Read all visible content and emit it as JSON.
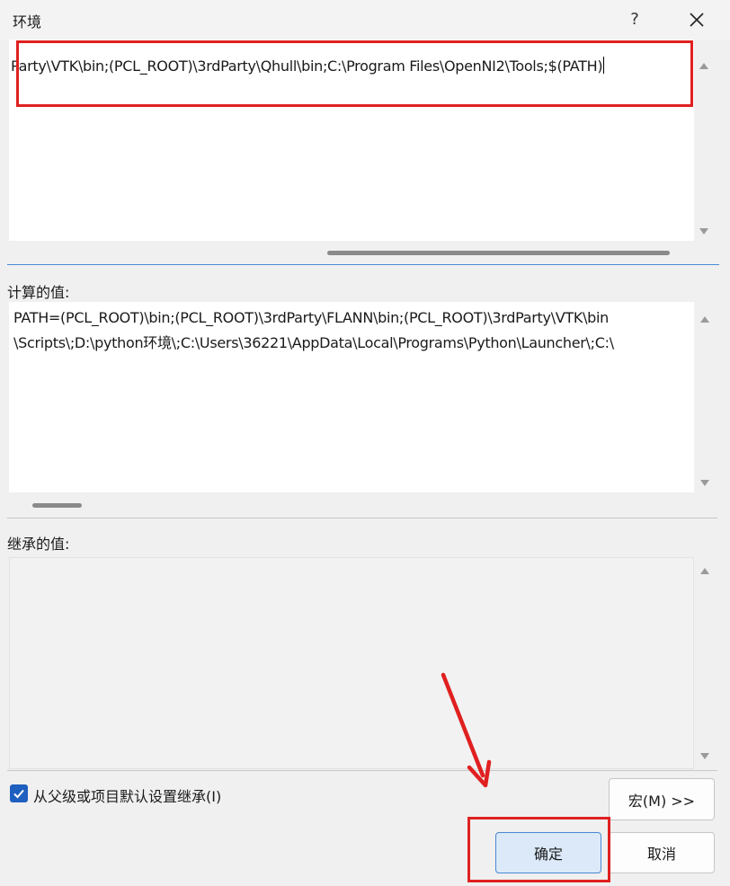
{
  "window": {
    "title": "环境",
    "help_label": "?"
  },
  "editor": {
    "text": "Party\\VTK\\bin;(PCL_ROOT)\\3rdParty\\Qhull\\bin;C:\\Program Files\\OpenNI2\\Tools;$(PATH)"
  },
  "computed": {
    "label": "计算的值:",
    "lines": [
      "PATH=(PCL_ROOT)\\bin;(PCL_ROOT)\\3rdParty\\FLANN\\bin;(PCL_ROOT)\\3rdParty\\VTK\\bin",
      "\\Scripts\\;D:\\python环境\\;C:\\Users\\36221\\AppData\\Local\\Programs\\Python\\Launcher\\;C:\\"
    ]
  },
  "inherited": {
    "label": "继承的值:"
  },
  "inherit_checkbox": {
    "label": "从父级或项目默认设置继承(I)",
    "checked": true
  },
  "buttons": {
    "macro": "宏(M) >>",
    "ok": "确定",
    "cancel": "取消"
  },
  "colors": {
    "annotation": "#e02020",
    "accent": "#1f5fbf"
  },
  "icons": {
    "close": "close-icon",
    "check": "checkmark-icon",
    "annotation_arrow": "red-arrow-icon"
  }
}
